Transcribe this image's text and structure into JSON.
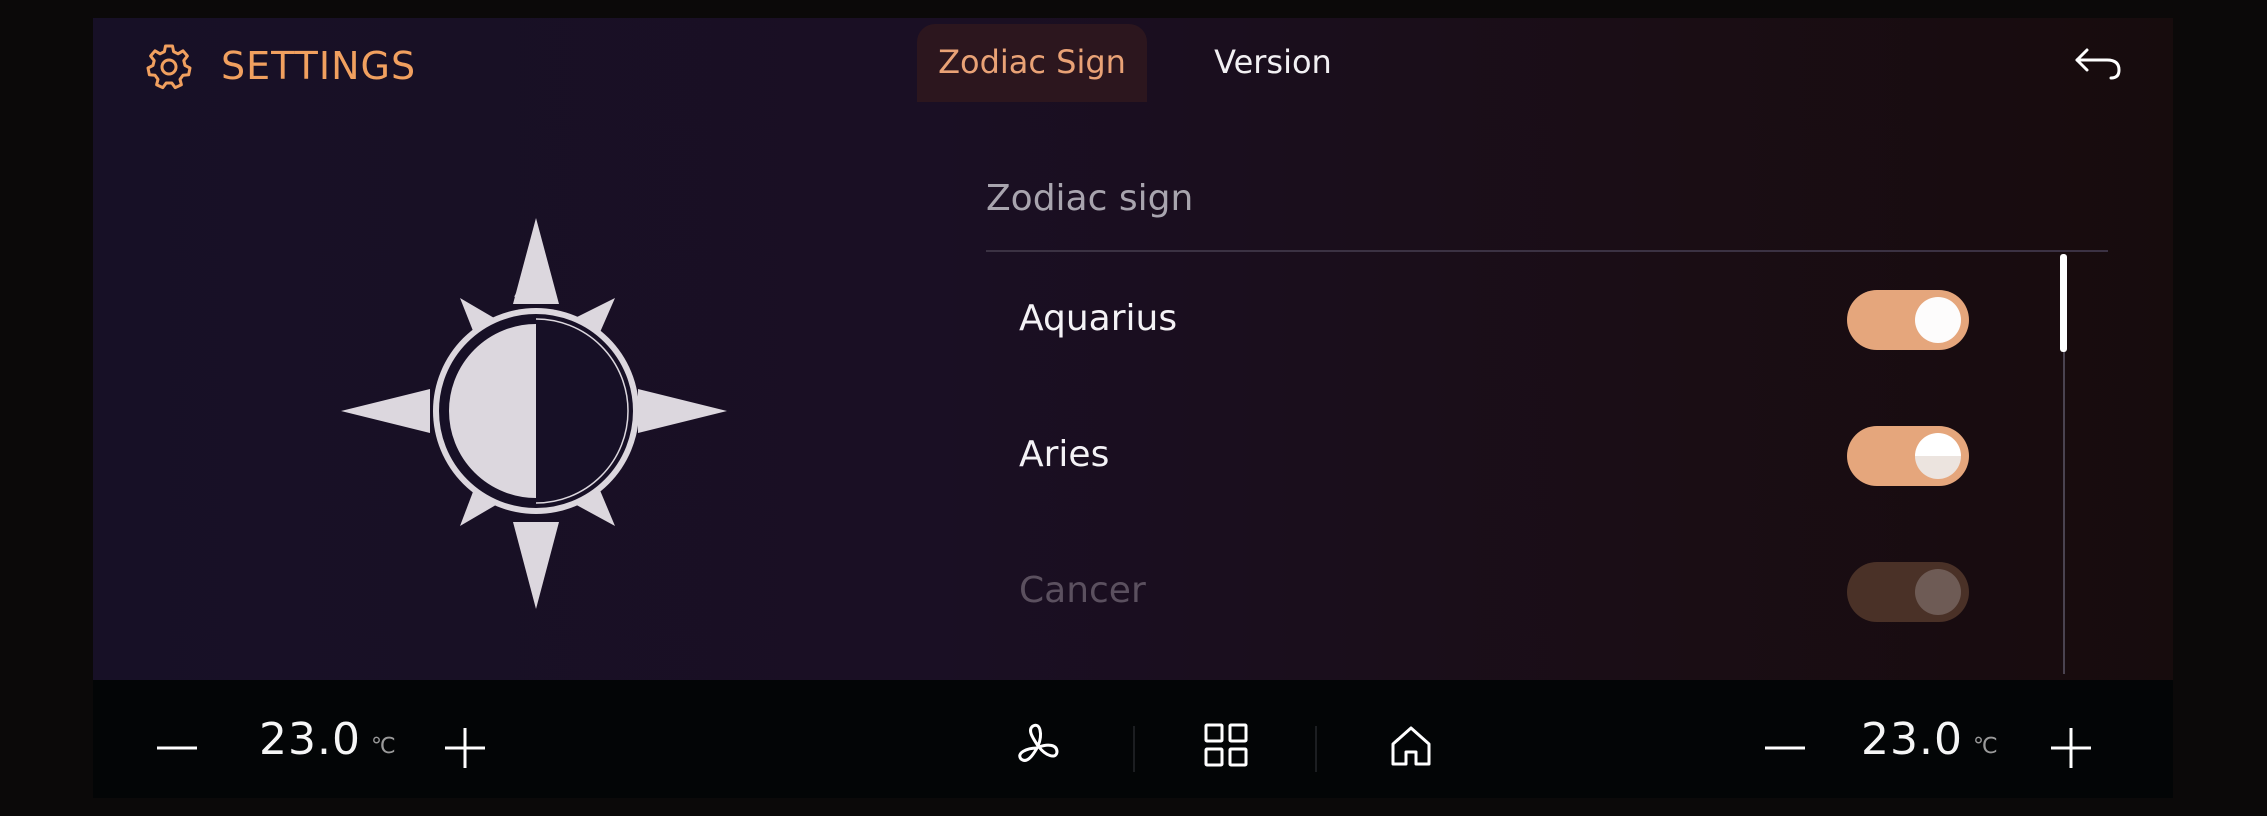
{
  "header": {
    "settings_icon": "gear-icon",
    "title": "SETTINGS",
    "tabs": [
      {
        "label": "Zodiac Sign",
        "active": true
      },
      {
        "label": "Version",
        "active": false
      }
    ],
    "back_icon": "back-arrow-icon"
  },
  "illustration": {
    "icon": "sun-half-icon"
  },
  "list": {
    "heading": "Zodiac sign",
    "items": [
      {
        "label": "Aquarius",
        "enabled": true
      },
      {
        "label": "Aries",
        "enabled": true
      },
      {
        "label": "Cancer",
        "enabled": true,
        "faded": true
      }
    ],
    "scroll_position": 0.0
  },
  "bottom_bar": {
    "left_temp": {
      "value": "23.0",
      "unit": "℃",
      "minus_icon": "minus-icon",
      "plus_icon": "plus-icon"
    },
    "right_temp": {
      "value": "23.0",
      "unit": "℃",
      "minus_icon": "minus-icon",
      "plus_icon": "plus-icon"
    },
    "center_icons": [
      "fan-icon",
      "apps-grid-icon",
      "home-icon"
    ]
  },
  "colors": {
    "accent": "#f1a05f",
    "toggle_on": "#e5a67c",
    "active_tab_bg": "#2c161e",
    "background": "#171026",
    "bottom_bar": "#030506"
  }
}
